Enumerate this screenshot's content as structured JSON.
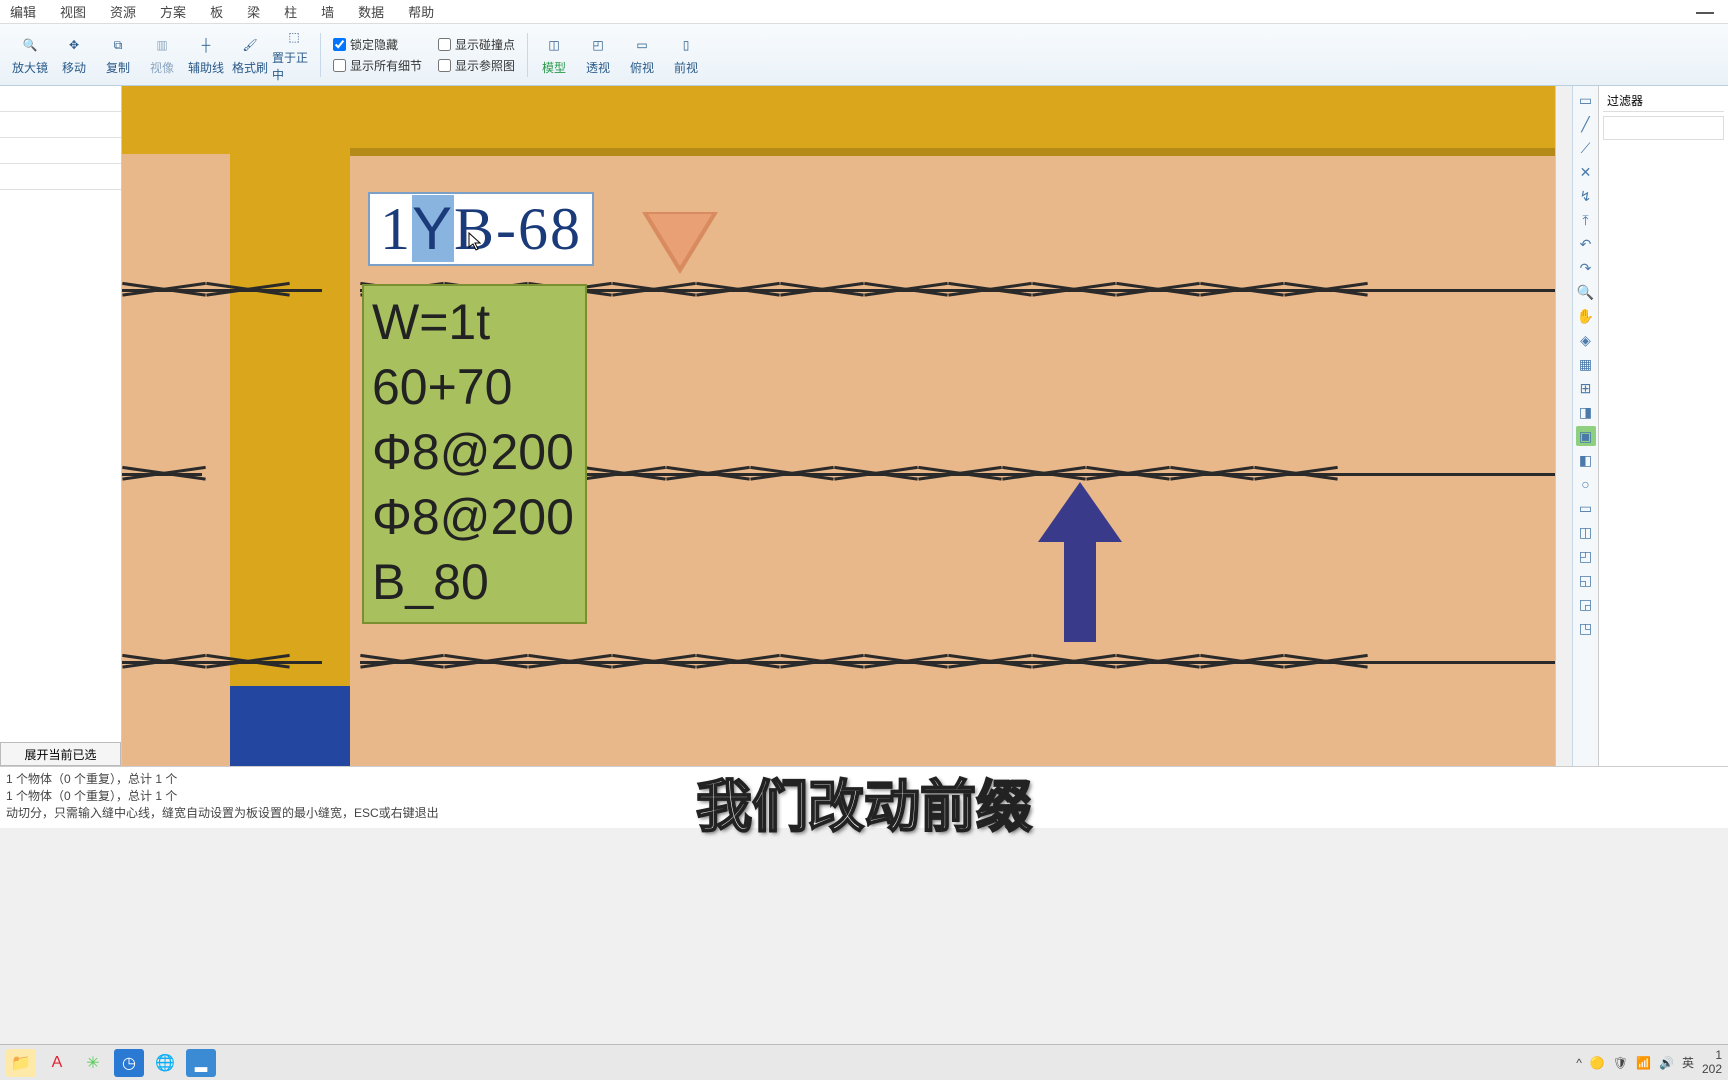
{
  "menu": [
    "编辑",
    "视图",
    "资源",
    "方案",
    "板",
    "梁",
    "柱",
    "墙",
    "数据",
    "帮助"
  ],
  "toolbar": {
    "btns": [
      {
        "label": "放大镜",
        "icon": "🔍"
      },
      {
        "label": "移动",
        "icon": "✥"
      },
      {
        "label": "复制",
        "icon": "⧉"
      },
      {
        "label": "视像",
        "icon": "▥"
      },
      {
        "label": "辅助线",
        "icon": "┼"
      },
      {
        "label": "格式刷",
        "icon": "🖌"
      },
      {
        "label": "置于正中",
        "icon": "⬚"
      }
    ],
    "chk1": [
      {
        "label": "锁定隐藏",
        "checked": true
      },
      {
        "label": "显示所有细节",
        "checked": false
      }
    ],
    "chk2": [
      {
        "label": "显示碰撞点",
        "checked": false
      },
      {
        "label": "显示参照图",
        "checked": false
      }
    ],
    "views": [
      {
        "label": "模型",
        "icon": "◫",
        "hl": true
      },
      {
        "label": "透视",
        "icon": "◰"
      },
      {
        "label": "俯视",
        "icon": "▭"
      },
      {
        "label": "前视",
        "icon": "▯"
      }
    ]
  },
  "left_panel": {
    "expand_btn": "展开当前已选"
  },
  "canvas": {
    "label_text": "1YB-68",
    "label_highlight_char": "Y",
    "info_lines": [
      "W=1t",
      "60+70",
      "Φ8@200",
      "Φ8@200",
      "B_80"
    ]
  },
  "right_tools": [
    "▭",
    "╱",
    "⟋",
    "✕",
    "↯",
    "⤒",
    "↶",
    "↷",
    "🔍",
    "✋",
    "◈",
    "▦",
    "⊞",
    "◨",
    "▣",
    "◧",
    "○",
    "▭",
    "◫",
    "◰",
    "◱",
    "◲",
    "◳"
  ],
  "right_hl_index": 14,
  "filter": {
    "header": "过滤器"
  },
  "log": [
    "1 个物体（0 个重复），总计 1 个",
    "1 个物体（0 个重复），总计 1 个",
    "动切分，只需输入缝中心线，缝宽自动设置为板设置的最小缝宽，ESC或右键退出"
  ],
  "subtitle": "我们改动前缀",
  "taskbar": {
    "apps": [
      {
        "color": "#ffd24a",
        "txt": "📁"
      },
      {
        "color": "#d23",
        "txt": "A"
      },
      {
        "color": "#5c5",
        "txt": "✳"
      },
      {
        "color": "#2a7ad4",
        "txt": "◷"
      },
      {
        "color": "#3ab",
        "txt": "🌐"
      },
      {
        "color": "#3a8ad4",
        "txt": "▂"
      }
    ],
    "tray": [
      "^",
      "🟡",
      "🛡",
      "📶",
      "🔊",
      "英"
    ],
    "time": "1",
    "date": "202"
  }
}
